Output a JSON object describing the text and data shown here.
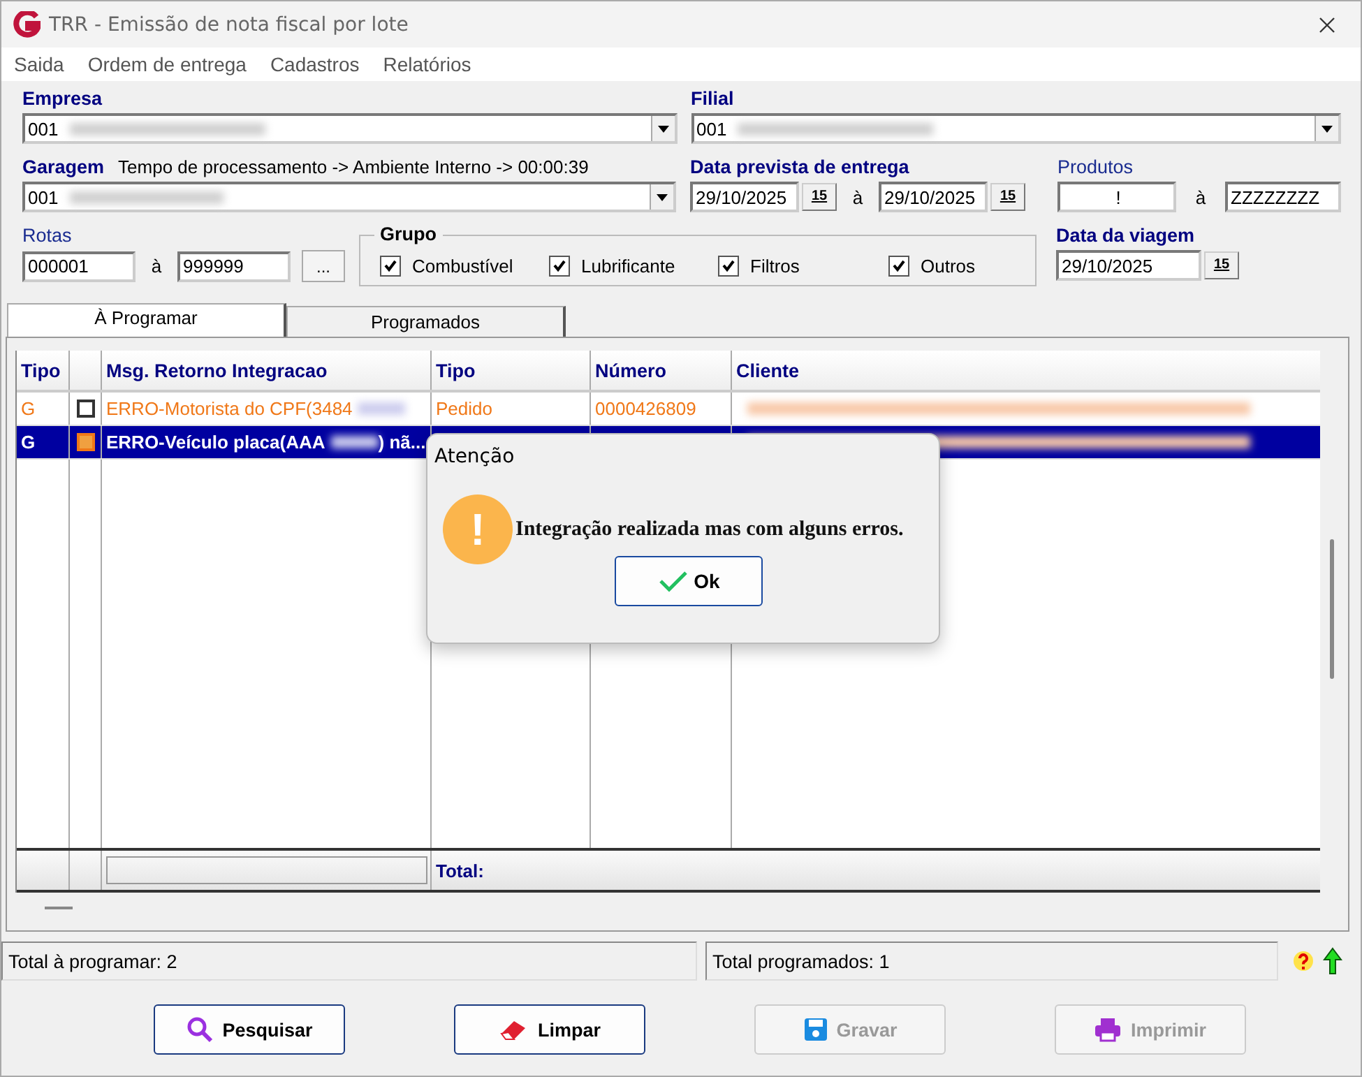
{
  "window": {
    "title": "TRR - Emissão de nota fiscal por lote"
  },
  "menu": [
    "Saida",
    "Ordem de entrega",
    "Cadastros",
    "Relatórios"
  ],
  "empresa": {
    "label": "Empresa",
    "value": "001",
    "blurred": true
  },
  "filial": {
    "label": "Filial",
    "value": "001",
    "blurred": true
  },
  "garagem": {
    "label": "Garagem",
    "note": "Tempo de processamento ->  Ambiente Interno -> 00:00:39",
    "value": "001",
    "blurred": true
  },
  "data_prevista": {
    "label": "Data prevista de entrega",
    "from": "29/10/2025",
    "calendar_from": "15",
    "sep": "à",
    "to": "29/10/2025",
    "calendar_to": "15"
  },
  "produtos": {
    "label": "Produtos",
    "from": "!",
    "sep": "à",
    "to": "ZZZZZZZZ"
  },
  "rotas": {
    "label": "Rotas",
    "from": "000001",
    "sep": "à",
    "to": "999999",
    "button": "..."
  },
  "grupo": {
    "label": "Grupo",
    "options": [
      {
        "label": "Combustível",
        "checked": true
      },
      {
        "label": "Lubrificante",
        "checked": true
      },
      {
        "label": "Filtros",
        "checked": true
      },
      {
        "label": "Outros",
        "checked": true
      }
    ]
  },
  "data_viagem": {
    "label": "Data da viagem",
    "value": "29/10/2025",
    "calendar": "15"
  },
  "tabs": [
    {
      "label": "À Programar",
      "selected": true
    },
    {
      "label": "Programados",
      "selected": false
    }
  ],
  "table": {
    "columns": [
      "Tipo",
      "",
      "Msg. Retorno Integracao",
      "Tipo",
      "Número",
      "Cliente"
    ],
    "rows": [
      {
        "tipo": "G",
        "checked": false,
        "msg": "ERRO-Motorista do CPF(3484",
        "msg_tail": "",
        "tipo2": "Pedido",
        "numero": "0000426809",
        "selected": false
      },
      {
        "tipo": "G",
        "checked": false,
        "msg": "ERRO-Veículo placa(AAA",
        "msg_tail": ") nã...",
        "tipo2": "",
        "numero": "",
        "selected": true
      }
    ],
    "total_label": "Total:"
  },
  "status_bar": [
    "Total à programar: 2",
    "Total programados: 1"
  ],
  "buttons": [
    {
      "label": "Pesquisar",
      "kind": "search",
      "disabled": false
    },
    {
      "label": "Limpar",
      "kind": "eraser",
      "disabled": false
    },
    {
      "label": "Gravar",
      "kind": "save",
      "disabled": true
    },
    {
      "label": "Imprimir",
      "kind": "print",
      "disabled": true
    }
  ],
  "dialog": {
    "title": "Atenção",
    "icon": "!",
    "message": "Integração realizada mas com alguns erros.",
    "button": "Ok"
  }
}
